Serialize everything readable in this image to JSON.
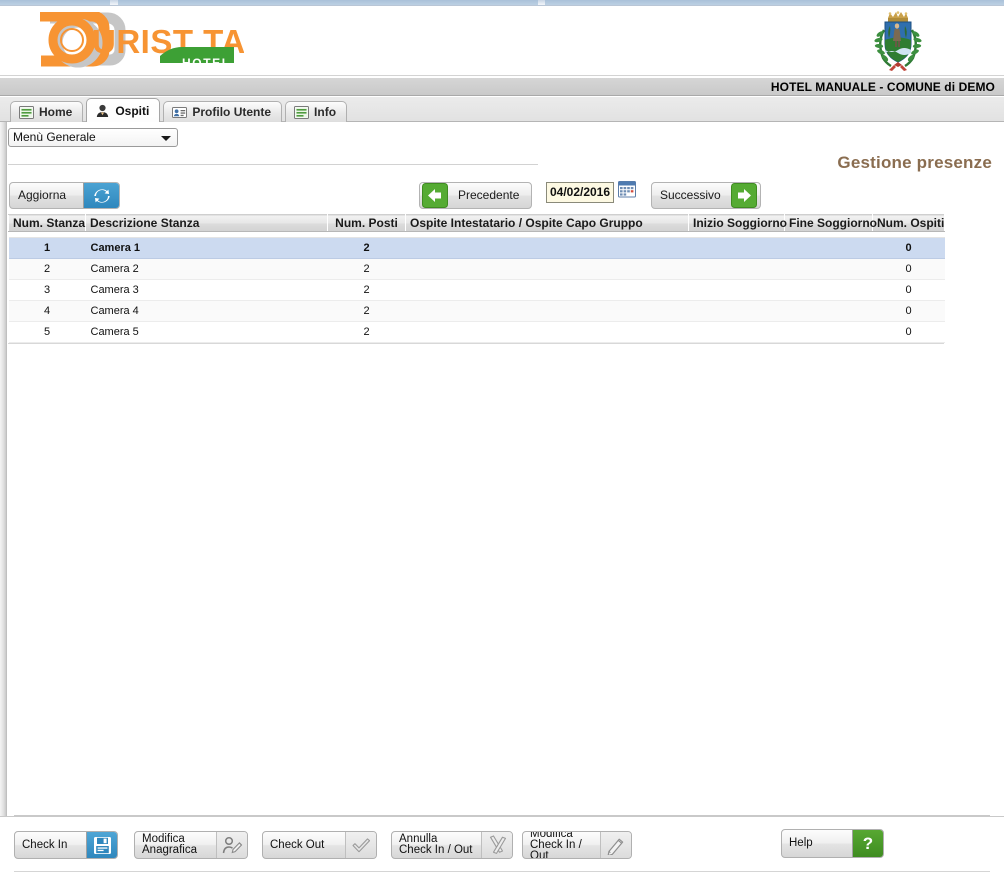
{
  "app": {
    "logo_text_primary": "URIST TAX",
    "logo_letter": "T",
    "logo_badge": "HOTEL",
    "emblem_name": "comune-coat-of-arms"
  },
  "org_bar": {
    "label": "HOTEL MANUALE - COMUNE di DEMO"
  },
  "tabs": [
    {
      "label": "Home",
      "icon": "document-icon",
      "active": false
    },
    {
      "label": "Ospiti",
      "icon": "person-icon",
      "active": true
    },
    {
      "label": "Profilo Utente",
      "icon": "id-card-icon",
      "active": false
    },
    {
      "label": "Info",
      "icon": "document-icon",
      "active": false
    }
  ],
  "menu": {
    "selected": "Menù Generale",
    "options": [
      "Menù Generale"
    ]
  },
  "page_title": "Gestione presenze",
  "toolbar": {
    "refresh_label": "Aggiorna",
    "refresh_icon": "refresh-icon",
    "prev_label": "Precedente",
    "prev_icon": "arrow-left-icon",
    "next_label": "Successivo",
    "next_icon": "arrow-right-icon",
    "date_value": "04/02/2016",
    "calendar_icon": "calendar-icon"
  },
  "table": {
    "columns": [
      "Num. Stanza",
      "Descrizione Stanza",
      "Num. Posti",
      "Ospite Intestatario / Ospite Capo Gruppo",
      "Inizio Soggiorno",
      "Fine Soggiorno",
      "Num. Ospiti"
    ],
    "rows": [
      {
        "num_stanza": "1",
        "descrizione": "Camera 1",
        "num_posti": "2",
        "ospite": "",
        "inizio": "",
        "fine": "",
        "num_ospiti": "0",
        "selected": true
      },
      {
        "num_stanza": "2",
        "descrizione": "Camera 2",
        "num_posti": "2",
        "ospite": "",
        "inizio": "",
        "fine": "",
        "num_ospiti": "0",
        "selected": false
      },
      {
        "num_stanza": "3",
        "descrizione": "Camera 3",
        "num_posti": "2",
        "ospite": "",
        "inizio": "",
        "fine": "",
        "num_ospiti": "0",
        "selected": false
      },
      {
        "num_stanza": "4",
        "descrizione": "Camera 4",
        "num_posti": "2",
        "ospite": "",
        "inizio": "",
        "fine": "",
        "num_ospiti": "0",
        "selected": false
      },
      {
        "num_stanza": "5",
        "descrizione": "Camera 5",
        "num_posti": "2",
        "ospite": "",
        "inizio": "",
        "fine": "",
        "num_ospiti": "0",
        "selected": false
      }
    ]
  },
  "bottom_toolbar": {
    "check_in": {
      "label": "Check In",
      "icon": "save-floppy-icon"
    },
    "modifica_anagrafica": {
      "label": "Modifica\nAnagrafica",
      "icon": "person-edit-icon"
    },
    "check_out": {
      "label": "Check Out",
      "icon": "check-icon"
    },
    "annulla_check": {
      "label": "Annulla\nCheck In / Out",
      "icon": "cancel-x-icon"
    },
    "modifica_check": {
      "label": "Modifica\nCheck In / Out",
      "icon": "pencil-icon"
    },
    "help": {
      "label": "Help",
      "icon": "question-mark-icon",
      "glyph": "?"
    }
  },
  "colors": {
    "brand_orange": "#F79433",
    "brand_green": "#3DA035",
    "accent_blue": "#2F87BD",
    "title_brown": "#8A6D50",
    "row_selected": "#CCDAF0"
  }
}
